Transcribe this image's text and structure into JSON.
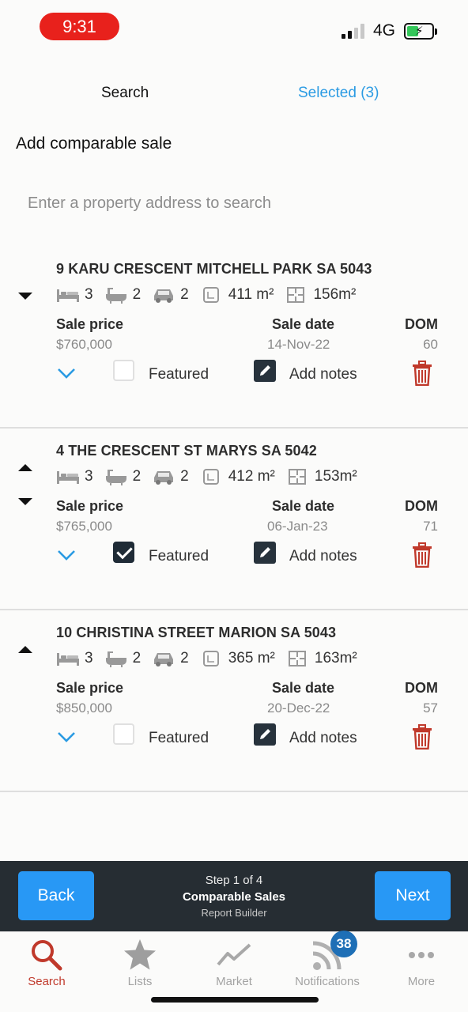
{
  "status_bar": {
    "time": "9:31",
    "network": "4G"
  },
  "tabs": {
    "search": "Search",
    "selected": "Selected (3)"
  },
  "section_title": "Add comparable sale",
  "search": {
    "placeholder": "Enter a property address to search"
  },
  "labels": {
    "sale_price": "Sale price",
    "sale_date": "Sale date",
    "dom": "DOM",
    "featured": "Featured",
    "add_notes": "Add notes"
  },
  "properties": [
    {
      "address": "9 KARU CRESCENT MITCHELL PARK SA 5043",
      "beds": "3",
      "baths": "2",
      "cars": "2",
      "land": "411 m²",
      "floor": "156m²",
      "price": "$760,000",
      "date": "14-Nov-22",
      "dom": "60",
      "featured": false
    },
    {
      "address": "4 THE CRESCENT ST MARYS SA 5042",
      "beds": "3",
      "baths": "2",
      "cars": "2",
      "land": "412 m²",
      "floor": "153m²",
      "price": "$765,000",
      "date": "06-Jan-23",
      "dom": "71",
      "featured": true
    },
    {
      "address": "10 CHRISTINA STREET MARION SA 5043",
      "beds": "3",
      "baths": "2",
      "cars": "2",
      "land": "365 m²",
      "floor": "163m²",
      "price": "$850,000",
      "date": "20-Dec-22",
      "dom": "57",
      "featured": false
    }
  ],
  "footer": {
    "back": "Back",
    "next": "Next",
    "step": "Step 1 of 4",
    "title": "Comparable Sales",
    "subtitle": "Report Builder"
  },
  "nav": {
    "search": "Search",
    "lists": "Lists",
    "market": "Market",
    "notifications": "Notifications",
    "notifications_badge": "38",
    "more": "More"
  },
  "colors": {
    "accent": "#2b9be3",
    "danger": "#c0392b",
    "footer_bg": "#262d33",
    "button": "#2898f5"
  }
}
